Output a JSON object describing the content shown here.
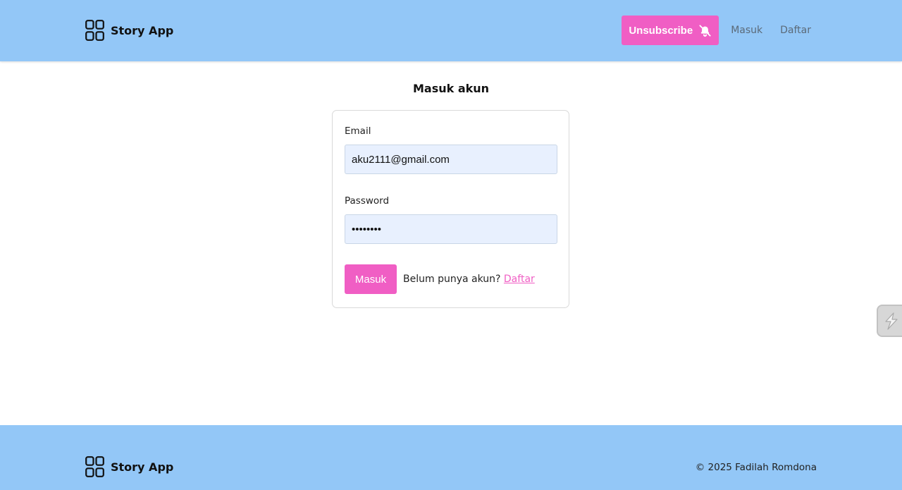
{
  "app": {
    "name": "Story App"
  },
  "header": {
    "unsubscribe_label": "Unsubscribe",
    "nav_links": [
      "Masuk",
      "Daftar"
    ]
  },
  "login": {
    "title": "Masuk akun",
    "email_label": "Email",
    "email_value": "aku2111@gmail.com",
    "password_label": "Password",
    "password_value": "••••••••",
    "submit_label": "Masuk",
    "signup_prompt": "Belum punya akun?",
    "signup_link": "Daftar"
  },
  "footer": {
    "copyright": "© 2025 Fadilah Romdona"
  },
  "icons": {
    "brand": "grid-icon",
    "unsubscribe": "bell-off-icon",
    "side_widget": "lightning-icon"
  },
  "colors": {
    "header_bg": "#93c7f7",
    "accent": "#f05ec4",
    "input_bg": "#e8f0fe"
  }
}
